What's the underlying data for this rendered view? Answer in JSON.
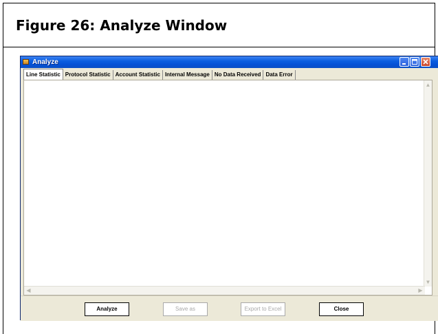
{
  "figure": {
    "title": "Figure 26:  Analyze Window"
  },
  "window": {
    "title": "Analyze",
    "tabs": [
      {
        "label": "Line Statistic",
        "active": true
      },
      {
        "label": "Protocol Statistic"
      },
      {
        "label": "Account Statistic"
      },
      {
        "label": "Internal Message"
      },
      {
        "label": "No Data Received"
      },
      {
        "label": "Data Error"
      }
    ],
    "buttons": {
      "analyze": "Analyze",
      "save_as": "Save as",
      "export": "Export to Excel",
      "close": "Close"
    }
  }
}
